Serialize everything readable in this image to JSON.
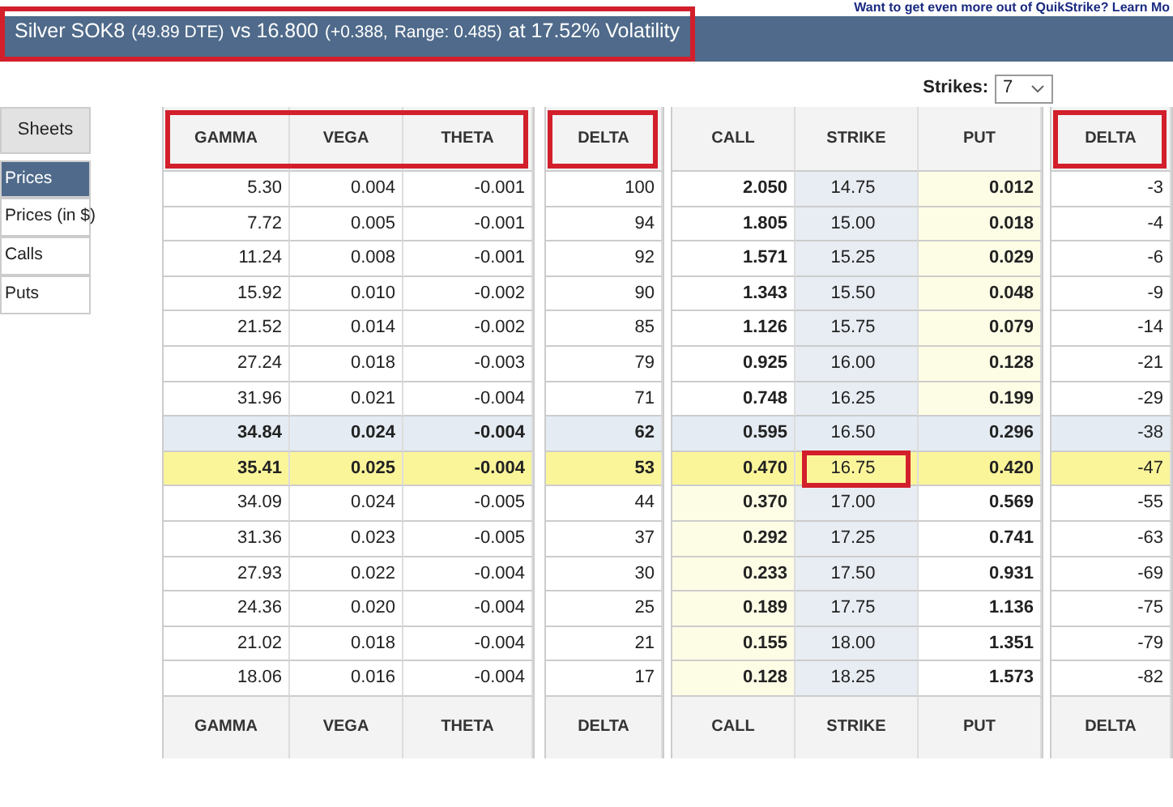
{
  "top_link": "Want to get even more out of QuikStrike? Learn Mo",
  "title": {
    "highlighted": true,
    "parts": [
      {
        "text": "Silver SOK8",
        "small": false
      },
      {
        "text": "(49.89 DTE)",
        "small": true
      },
      {
        "text": "vs 16.800",
        "small": false
      },
      {
        "text": "(+0.388,",
        "small": true
      },
      {
        "text": "Range: 0.485)",
        "small": true
      },
      {
        "text": "at 17.52% Volatility",
        "small": false
      }
    ]
  },
  "strikes": {
    "label": "Strikes:",
    "value": "7"
  },
  "sidebar": {
    "header": "Sheets",
    "items": [
      {
        "label": "Prices",
        "selected": true
      },
      {
        "label": "Prices (in $)",
        "selected": false
      },
      {
        "label": "Calls",
        "selected": false
      },
      {
        "label": "Puts",
        "selected": false
      }
    ]
  },
  "greeks_columns": {
    "highlighted": true,
    "labels": [
      "GAMMA",
      "VEGA",
      "THETA"
    ]
  },
  "call_delta_column": {
    "highlighted": true,
    "label": "DELTA"
  },
  "main_columns": [
    "CALL",
    "STRIKE",
    "PUT"
  ],
  "put_delta_column": {
    "highlighted": true,
    "label": "DELTA"
  },
  "rows": [
    {
      "call_itm": true,
      "near": false,
      "atm": false,
      "gamma": "5.30",
      "vega": "0.004",
      "theta": "-0.001",
      "call_delta": "100",
      "call": "2.050",
      "strike": "14.75",
      "put": "0.012",
      "put_delta": "-3"
    },
    {
      "call_itm": true,
      "near": false,
      "atm": false,
      "gamma": "7.72",
      "vega": "0.005",
      "theta": "-0.001",
      "call_delta": "94",
      "call": "1.805",
      "strike": "15.00",
      "put": "0.018",
      "put_delta": "-4"
    },
    {
      "call_itm": true,
      "near": false,
      "atm": false,
      "gamma": "11.24",
      "vega": "0.008",
      "theta": "-0.001",
      "call_delta": "92",
      "call": "1.571",
      "strike": "15.25",
      "put": "0.029",
      "put_delta": "-6"
    },
    {
      "call_itm": true,
      "near": false,
      "atm": false,
      "gamma": "15.92",
      "vega": "0.010",
      "theta": "-0.002",
      "call_delta": "90",
      "call": "1.343",
      "strike": "15.50",
      "put": "0.048",
      "put_delta": "-9"
    },
    {
      "call_itm": true,
      "near": false,
      "atm": false,
      "gamma": "21.52",
      "vega": "0.014",
      "theta": "-0.002",
      "call_delta": "85",
      "call": "1.126",
      "strike": "15.75",
      "put": "0.079",
      "put_delta": "-14"
    },
    {
      "call_itm": true,
      "near": false,
      "atm": false,
      "gamma": "27.24",
      "vega": "0.018",
      "theta": "-0.003",
      "call_delta": "79",
      "call": "0.925",
      "strike": "16.00",
      "put": "0.128",
      "put_delta": "-21"
    },
    {
      "call_itm": true,
      "near": false,
      "atm": false,
      "gamma": "31.96",
      "vega": "0.021",
      "theta": "-0.004",
      "call_delta": "71",
      "call": "0.748",
      "strike": "16.25",
      "put": "0.199",
      "put_delta": "-29"
    },
    {
      "near": true,
      "atm": false,
      "gamma": "34.84",
      "vega": "0.024",
      "theta": "-0.004",
      "call_delta": "62",
      "call": "0.595",
      "strike": "16.50",
      "put": "0.296",
      "put_delta": "-38"
    },
    {
      "near": false,
      "atm": true,
      "gamma": "35.41",
      "vega": "0.025",
      "theta": "-0.004",
      "call_delta": "53",
      "call": "0.470",
      "strike": "16.75",
      "put": "0.420",
      "put_delta": "-47",
      "strike_highlighted": true
    },
    {
      "call_itm": false,
      "near": false,
      "atm": false,
      "gamma": "34.09",
      "vega": "0.024",
      "theta": "-0.005",
      "call_delta": "44",
      "call": "0.370",
      "strike": "17.00",
      "put": "0.569",
      "put_delta": "-55"
    },
    {
      "call_itm": false,
      "near": false,
      "atm": false,
      "gamma": "31.36",
      "vega": "0.023",
      "theta": "-0.005",
      "call_delta": "37",
      "call": "0.292",
      "strike": "17.25",
      "put": "0.741",
      "put_delta": "-63"
    },
    {
      "call_itm": false,
      "near": false,
      "atm": false,
      "gamma": "27.93",
      "vega": "0.022",
      "theta": "-0.004",
      "call_delta": "30",
      "call": "0.233",
      "strike": "17.50",
      "put": "0.931",
      "put_delta": "-69"
    },
    {
      "call_itm": false,
      "near": false,
      "atm": false,
      "gamma": "24.36",
      "vega": "0.020",
      "theta": "-0.004",
      "call_delta": "25",
      "call": "0.189",
      "strike": "17.75",
      "put": "1.136",
      "put_delta": "-75"
    },
    {
      "call_itm": false,
      "near": false,
      "atm": false,
      "gamma": "21.02",
      "vega": "0.018",
      "theta": "-0.004",
      "call_delta": "21",
      "call": "0.155",
      "strike": "18.00",
      "put": "1.351",
      "put_delta": "-79"
    },
    {
      "call_itm": false,
      "near": false,
      "atm": false,
      "gamma": "18.06",
      "vega": "0.016",
      "theta": "-0.004",
      "call_delta": "17",
      "call": "0.128",
      "strike": "18.25",
      "put": "1.573",
      "put_delta": "-82"
    }
  ],
  "footer": {
    "greeks": [
      "GAMMA",
      "VEGA",
      "THETA"
    ],
    "call_delta": "DELTA",
    "main": [
      "CALL",
      "STRIKE",
      "PUT"
    ],
    "put_delta": "DELTA"
  }
}
